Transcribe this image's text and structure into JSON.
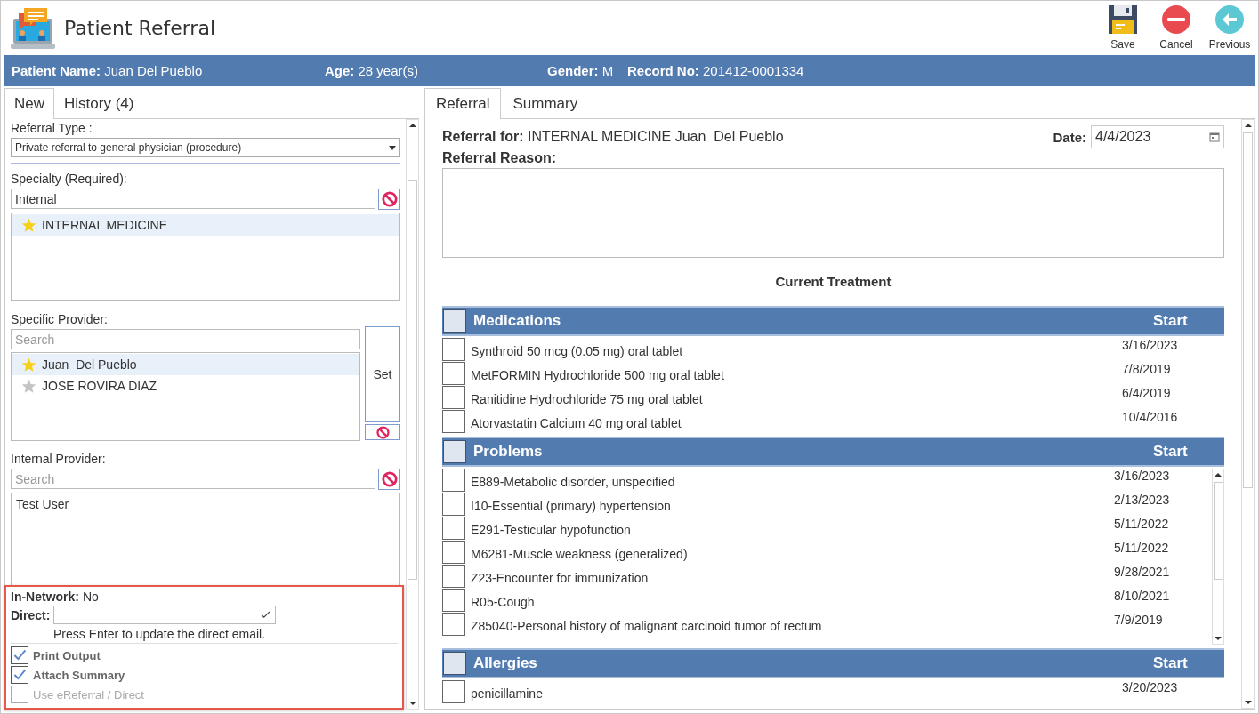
{
  "app": {
    "title": "Patient Referral"
  },
  "toolbar": [
    {
      "kind": "save",
      "label": "Save"
    },
    {
      "kind": "cancel",
      "label": "Cancel"
    },
    {
      "kind": "previous",
      "label": "Previous"
    }
  ],
  "patient_bar": [
    {
      "label": "Patient Name:",
      "value": "Juan Del Pueblo"
    },
    {
      "label": "Age:",
      "value": "28 year(s)"
    },
    {
      "label": "Gender:",
      "value": "M"
    },
    {
      "label": "Record No:",
      "value": "201412-0001334"
    }
  ],
  "left_tabs": [
    {
      "label": "New",
      "selected": true
    },
    {
      "label": "History (4)",
      "selected": false
    }
  ],
  "referral_type": {
    "label": "Referral Type :",
    "value": "Private referral to general physician (procedure)"
  },
  "specialty": {
    "label": "Specialty (Required):",
    "value": "Internal",
    "items": [
      {
        "name": "INTERNAL MEDICINE",
        "favorite": true,
        "selected": true
      }
    ]
  },
  "specific_provider": {
    "label": "Specific Provider:",
    "placeholder": "Search",
    "set_button": "Set",
    "items": [
      {
        "name": "Juan  Del Pueblo",
        "favorite": true,
        "selected": true
      },
      {
        "name": "JOSE ROVIRA DIAZ",
        "favorite": false,
        "selected": false
      }
    ]
  },
  "internal_provider": {
    "label": "Internal Provider:",
    "placeholder": "Search",
    "items": [
      {
        "name": "Test User",
        "selected": false
      }
    ]
  },
  "in_network": {
    "label": "In-Network:",
    "value": "No"
  },
  "direct": {
    "label": "Direct:",
    "hint": "Press Enter to update the direct email."
  },
  "options": [
    {
      "label": "Print Output",
      "checked": true,
      "disabled": false
    },
    {
      "label": "Attach Summary",
      "checked": true,
      "disabled": false
    },
    {
      "label": "Use eReferral / Direct",
      "checked": false,
      "disabled": true
    }
  ],
  "right_tabs": [
    {
      "label": "Referral",
      "selected": true
    },
    {
      "label": "Summary",
      "selected": false
    }
  ],
  "referral": {
    "label": "Referral for:",
    "value": "INTERNAL MEDICINE Juan  Del Pueblo",
    "date_label": "Date:",
    "date": "4/4/2023",
    "reason_label": "Referral Reason:"
  },
  "treatment_title": "Current Treatment",
  "sections": [
    {
      "title": "Medications",
      "column": "Start",
      "checked": false,
      "scrollable": false,
      "items": [
        {
          "label": "Synthroid 50 mcg (0.05 mg) oral tablet",
          "date": "3/16/2023",
          "checked": false
        },
        {
          "label": "MetFORMIN Hydrochloride 500 mg oral tablet",
          "date": "7/8/2019",
          "checked": false
        },
        {
          "label": "Ranitidine Hydrochloride 75 mg oral tablet",
          "date": "6/4/2019",
          "checked": false
        },
        {
          "label": "Atorvastatin Calcium 40 mg oral tablet",
          "date": "10/4/2016",
          "checked": false
        }
      ]
    },
    {
      "title": "Problems",
      "column": "Start",
      "checked": false,
      "scrollable": true,
      "items": [
        {
          "label": "E889-Metabolic disorder, unspecified",
          "date": "3/16/2023",
          "checked": false
        },
        {
          "label": "I10-Essential (primary) hypertension",
          "date": "2/13/2023",
          "checked": false
        },
        {
          "label": "E291-Testicular hypofunction",
          "date": "5/11/2022",
          "checked": false
        },
        {
          "label": "M6281-Muscle weakness (generalized)",
          "date": "5/11/2022",
          "checked": false
        },
        {
          "label": "Z23-Encounter for immunization",
          "date": "9/28/2021",
          "checked": false
        },
        {
          "label": "R05-Cough",
          "date": "8/10/2021",
          "checked": false
        },
        {
          "label": "Z85040-Personal history of malignant carcinoid tumor of rectum",
          "date": "7/9/2019",
          "checked": false
        }
      ]
    },
    {
      "title": "Allergies",
      "column": "Start",
      "checked": false,
      "scrollable": false,
      "items": [
        {
          "label": "penicillamine",
          "date": "3/20/2023",
          "checked": false
        }
      ]
    }
  ]
}
